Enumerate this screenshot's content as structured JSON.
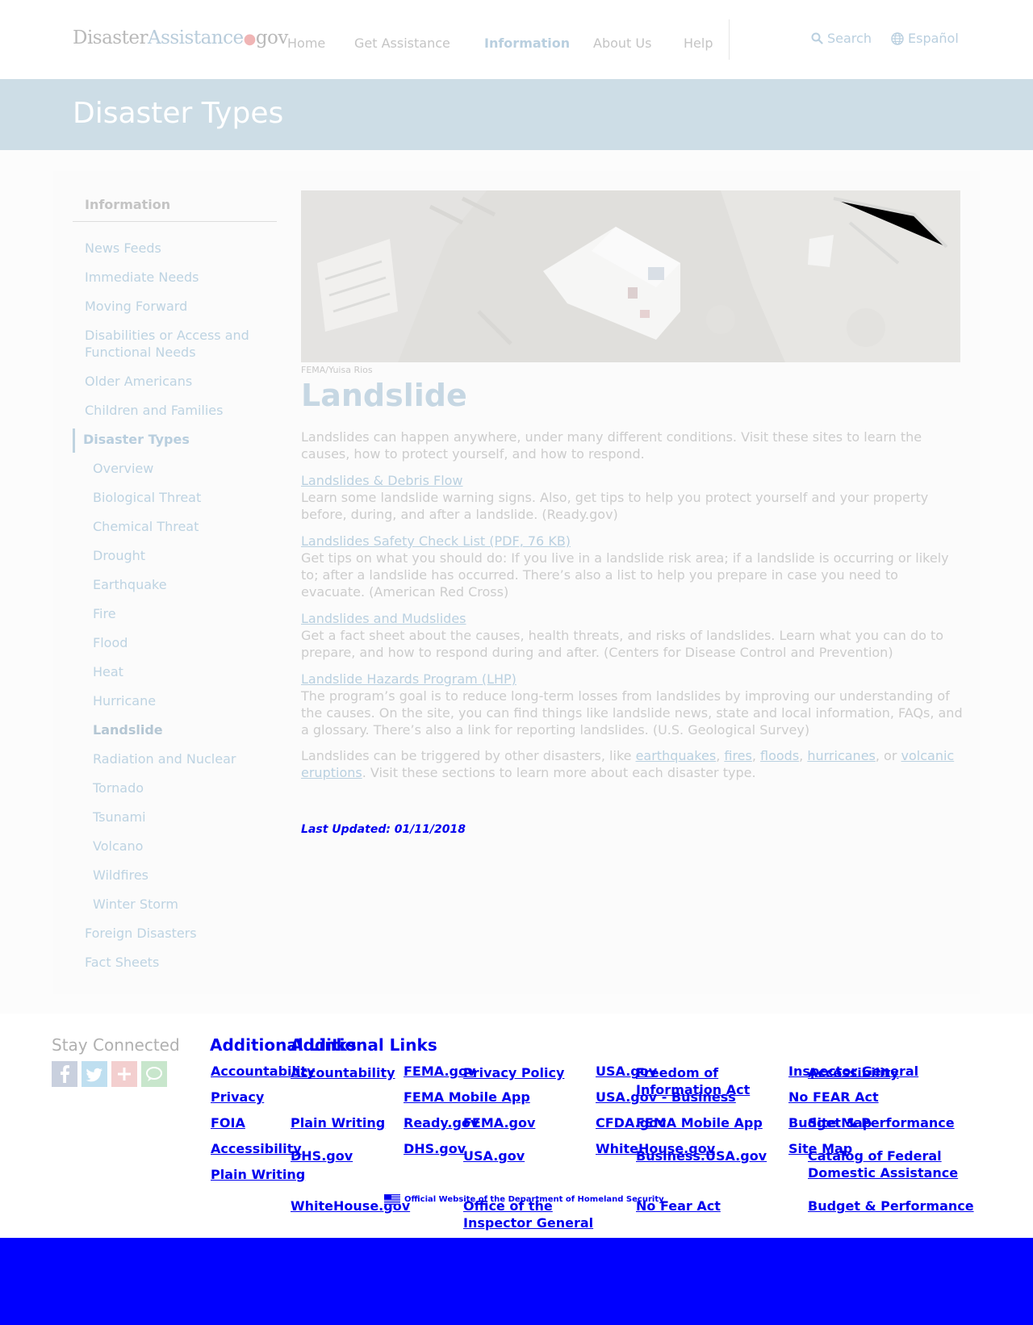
{
  "header": {
    "logo": {
      "part1": "Disaster",
      "part2": "Assistance",
      "dot": "●",
      "part3": "gov"
    },
    "nav": [
      {
        "label": "Home"
      },
      {
        "label": "Get Assistance"
      },
      {
        "label": "Information",
        "active": true
      },
      {
        "label": "About Us"
      },
      {
        "label": "Help"
      }
    ],
    "search_label": "Search",
    "language_label": "Español",
    "icons": {
      "search": "search-icon",
      "language": "globe-icon"
    }
  },
  "banner": {
    "title": "Disaster Types"
  },
  "sidebar": {
    "heading": "Information",
    "items": [
      {
        "label": "News Feeds"
      },
      {
        "label": "Immediate Needs"
      },
      {
        "label": "Moving Forward"
      },
      {
        "label": "Disabilities or Access and Functional Needs"
      },
      {
        "label": "Older Americans"
      },
      {
        "label": "Children and Families"
      },
      {
        "label": "Disaster Types",
        "section": true
      },
      {
        "label": "Overview"
      },
      {
        "label": "Biological Threat"
      },
      {
        "label": "Chemical Threat"
      },
      {
        "label": "Drought"
      },
      {
        "label": "Earthquake"
      },
      {
        "label": "Fire"
      },
      {
        "label": "Flood"
      },
      {
        "label": "Heat"
      },
      {
        "label": "Hurricane"
      },
      {
        "label": "Landslide",
        "current": true
      },
      {
        "label": "Radiation and Nuclear"
      },
      {
        "label": "Tornado"
      },
      {
        "label": "Tsunami"
      },
      {
        "label": "Volcano"
      },
      {
        "label": "Wildfires"
      },
      {
        "label": "Winter Storm"
      },
      {
        "label": "Foreign Disasters"
      },
      {
        "label": "Fact Sheets"
      }
    ]
  },
  "main": {
    "image_credit": "FEMA/Yuisa Rios",
    "title": "Landslide",
    "intro": "Landslides can happen anywhere, under many different conditions. Visit these sites to learn the causes, how to protect yourself, and how to respond.",
    "resources": [
      {
        "link": "Landslides & Debris Flow",
        "text": "Learn some landslide warning signs. Also, get tips to help you protect yourself and your property before, during, and after a landslide. (Ready.gov)"
      },
      {
        "link": "Landslides Safety Check List (PDF, 76 KB)",
        "text": "Get tips on what you should do: If you live in a landslide risk area; if a landslide is occurring or likely to; after a landslide has occurred. There’s also a list to help you prepare in case you need to evacuate. (American Red Cross)"
      },
      {
        "link": "Landslides and Mudslides",
        "text": "Get a fact sheet about the causes, health threats, and risks of landslides. Learn what you can do to prepare, and how to respond during and after. (Centers for Disease Control and Prevention)"
      },
      {
        "link": "Landslide Hazards Program (LHP)",
        "text": "The program’s goal is to reduce long-term losses from landslides by improving our understanding of the causes. On the site, you can find things like landslide news, state and local information, FAQs, and a glossary. There’s also a link for reporting landslides. (U.S. Geological Survey)"
      }
    ],
    "closing": {
      "prefix": "Landslides can be triggered by other disasters, like ",
      "links": [
        "earthquakes",
        "fires",
        "floods",
        "hurricanes",
        "volcanic eruptions"
      ],
      "sep1": ", ",
      "or": ", or",
      "suffix": ". Visit these sections to learn more about each disaster type."
    },
    "last_updated": "Last Updated: 01/11/2018"
  },
  "footer": {
    "stay_connected": "Stay Connected",
    "social_icons": [
      "facebook-icon",
      "twitter-icon",
      "google-plus-icon",
      "chat-icon"
    ],
    "heading_a": "Additional Links",
    "heading_b": "Additional Links",
    "layer1": {
      "col1": [
        "Accountability",
        "Privacy",
        "FOIA",
        "Accessibility",
        "Plain Writing"
      ],
      "col2": [
        "FEMA.gov",
        "FEMA Mobile App",
        "Ready.gov",
        "DHS.gov"
      ],
      "col3": [
        "USA.gov",
        "USA.gov - Business",
        "CFDA.gov",
        "WhiteHouse.gov"
      ],
      "col4": [
        "Inspector General",
        "No FEAR Act",
        "Budget & Performance",
        "Site Map"
      ]
    },
    "layer2": {
      "col1": [
        "Accountability",
        "Plain Writing",
        "DHS.gov",
        "WhiteHouse.gov"
      ],
      "col2": [
        "Privacy Policy",
        "FEMA.gov",
        "USA.gov",
        "Office of the Inspector General"
      ],
      "col3": [
        "Freedom of Information Act",
        "FEMA Mobile App",
        "Business.USA.gov",
        "No Fear Act"
      ],
      "col4": [
        "Accessibility",
        "Site Map",
        "Catalog of Federal Domestic Assistance",
        "Budget & Performance"
      ]
    },
    "official": "Official Website of the Department of Homeland Security",
    "flag_icon": "us-flag-icon"
  },
  "colors": {
    "banner": "#cddde6",
    "link": "#0000ee",
    "bottom_bar": "#0000ff"
  }
}
